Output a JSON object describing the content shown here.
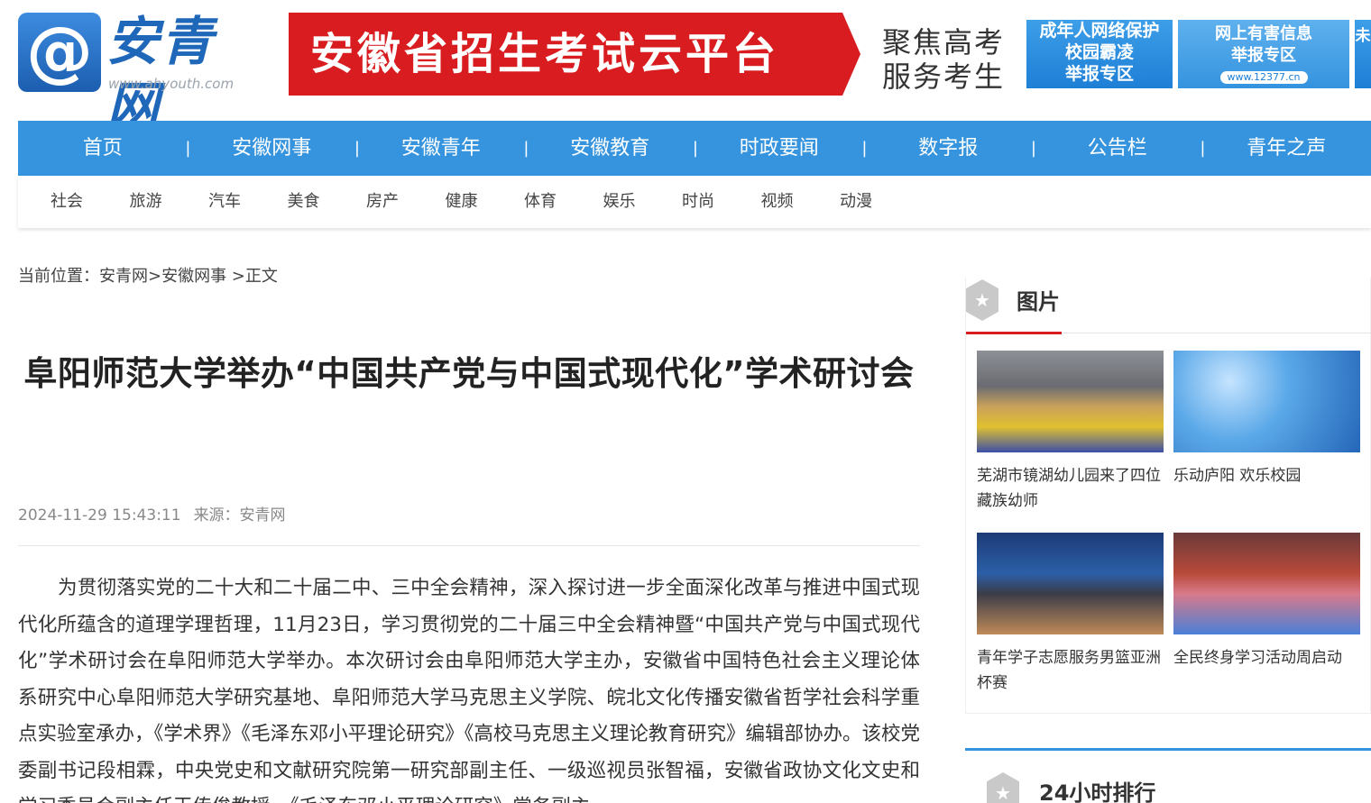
{
  "header": {
    "logo_symbol": "@",
    "logo_name": "安青网",
    "logo_url": "www.ahyouth.com",
    "banner_title": "安徽省招生考试云平台",
    "banner_sub": "聚焦高考 服务考生",
    "ad1_lines": [
      "成年人网络保护",
      "校园霸凌",
      "举报专区"
    ],
    "ad2_lines": [
      "网上有害信息",
      "举报专区"
    ],
    "ad2_url": "www.12377.cn",
    "ad3_char": "未"
  },
  "nav": {
    "items": [
      "首页",
      "安徽网事",
      "安徽青年",
      "安徽教育",
      "时政要闻",
      "数字报",
      "公告栏",
      "青年之声"
    ],
    "separator": "|"
  },
  "subnav": {
    "items": [
      "社会",
      "旅游",
      "汽车",
      "美食",
      "房产",
      "健康",
      "体育",
      "娱乐",
      "时尚",
      "视频",
      "动漫"
    ]
  },
  "article": {
    "breadcrumb": "当前位置：安青网>安徽网事 >正文",
    "title": "阜阳师范大学举办“中国共产党与中国式现代化”学术研讨会",
    "date": "2024-11-29 15:43:11",
    "source": "来源：安青网",
    "body": "为贯彻落实党的二十大和二十届二中、三中全会精神，深入探讨进一步全面深化改革与推进中国式现代化所蕴含的道理学理哲理，11月23日，学习贯彻党的二十届三中全会精神暨“中国共产党与中国式现代化”学术研讨会在阜阳师范大学举办。本次研讨会由阜阳师范大学主办，安徽省中国特色社会主义理论体系研究中心阜阳师范大学研究基地、阜阳师范大学马克思主义学院、皖北文化传播安徽省哲学社会科学重点实验室承办，《学术界》《毛泽东邓小平理论研究》《高校马克思主义理论教育研究》编辑部协办。该校党委副书记段相霖，中央党史和文献研究院第一研究部副主任、一级巡视员张智福，安徽省政协文化文史和学习委员会副主任王传俊教授，《毛泽东邓小平理论研究》常务副主"
  },
  "sidebar": {
    "photo_title": "图片",
    "photos": [
      {
        "caption": "芜湖市镜湖幼儿园来了四位藏族幼师"
      },
      {
        "caption": "乐动庐阳 欢乐校园"
      },
      {
        "caption": "青年学子志愿服务男篮亚洲杯赛"
      },
      {
        "caption": "全民终身学习活动周启动"
      }
    ],
    "ranking_title": "24小时排行",
    "icon_glyph": "★"
  },
  "colors": {
    "nav_blue": "#3594dd",
    "accent_red": "#d81c1f",
    "logo_blue": "#1f67b8"
  }
}
